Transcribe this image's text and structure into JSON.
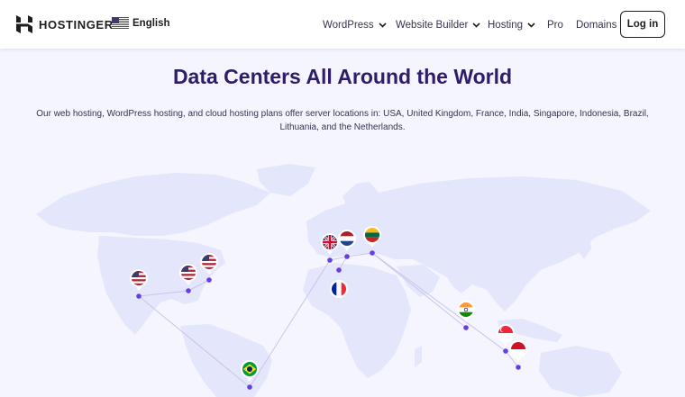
{
  "header": {
    "brand": "HOSTINGER",
    "language": "English",
    "nav": [
      {
        "label": "WordPress",
        "has_dropdown": true
      },
      {
        "label": "Website Builder",
        "has_dropdown": true
      },
      {
        "label": "Hosting",
        "has_dropdown": true
      },
      {
        "label": "Pro",
        "has_dropdown": false
      },
      {
        "label": "Domains",
        "has_dropdown": false
      }
    ],
    "login_label": "Log in"
  },
  "hero": {
    "title": "Data Centers All Around the World",
    "subtitle": "Our web hosting, WordPress hosting, and cloud hosting plans offer server locations in: USA, United Kingdom, France, India, Singapore, Indonesia, Brazil, Lithuania, and the Netherlands."
  },
  "map": {
    "land_color": "#e4e6fb",
    "route_color": "#c9c4ea",
    "dot_color": "#673de6",
    "locations": [
      "USA (West)",
      "USA (Central)",
      "USA (East)",
      "United Kingdom",
      "Netherlands",
      "Lithuania",
      "France",
      "India",
      "Singapore",
      "Indonesia",
      "Brazil"
    ]
  },
  "colors": {
    "accent": "#673de6",
    "heading": "#2f1c6a",
    "background": "#f4f5ff"
  }
}
